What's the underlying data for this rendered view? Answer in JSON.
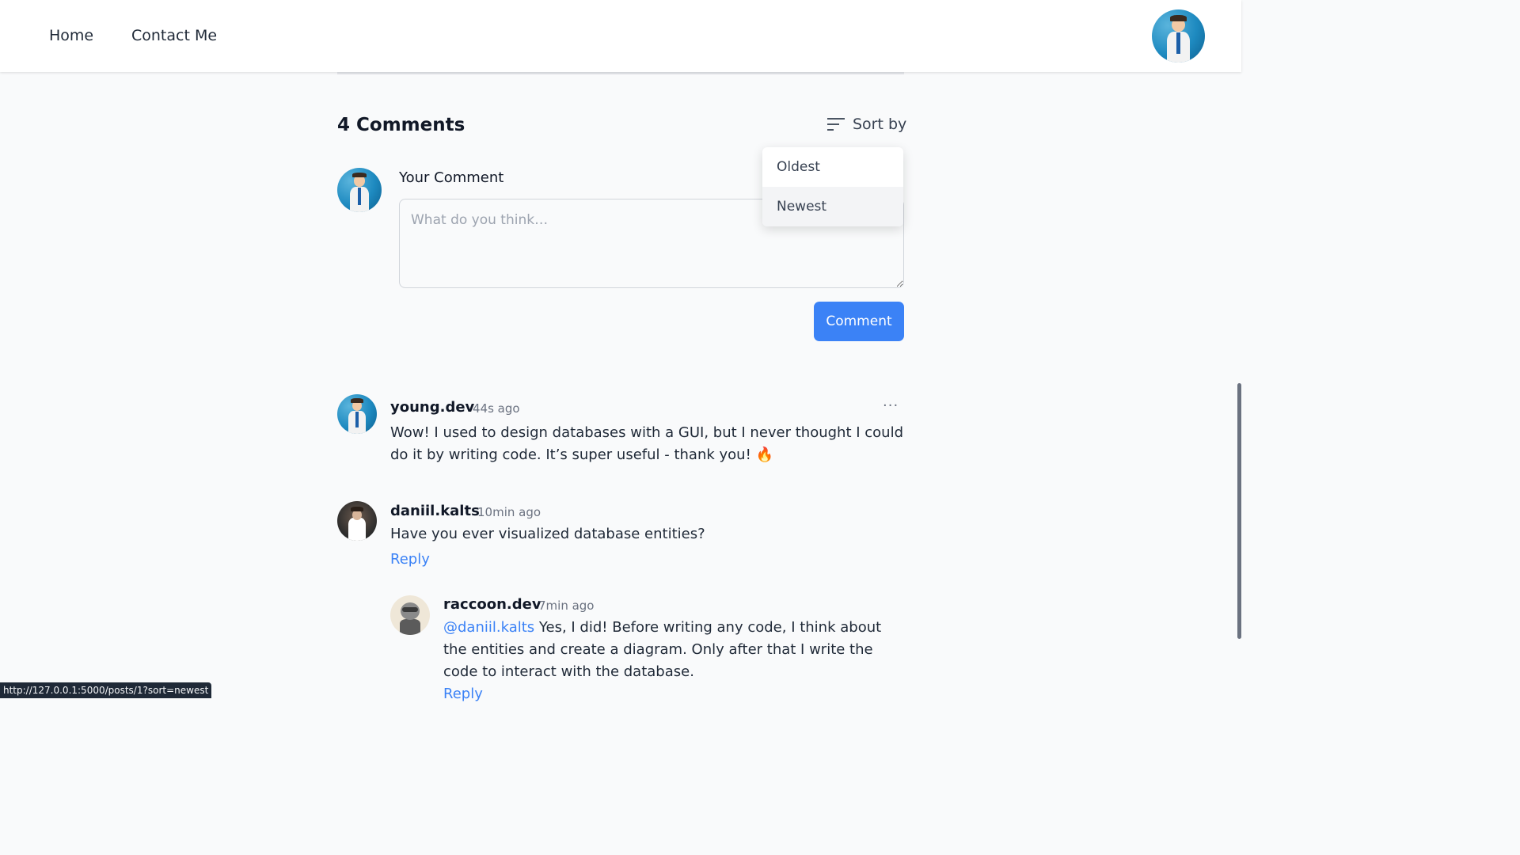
{
  "nav": {
    "home": "Home",
    "contact": "Contact Me"
  },
  "comments": {
    "count_label": "4 Comments",
    "sort_label": "Sort by",
    "sort_options": [
      "Oldest",
      "Newest"
    ],
    "selected_sort": "Newest"
  },
  "compose": {
    "label": "Your Comment",
    "placeholder": "What do you think…",
    "value": "",
    "submit_label": "Comment"
  },
  "items": [
    {
      "author": "young.dev",
      "time": "44s ago",
      "text": "Wow! I used to design databases with a GUI, but I never thought I could do it by writing code. It’s super useful - thank you! 🔥",
      "more": "···"
    },
    {
      "author": "daniil.kalts",
      "time": "10min ago",
      "text": "Have you ever visualized database entities?",
      "reply": "Reply"
    },
    {
      "author": "raccoon.dev",
      "time": "7min ago",
      "mention": "@daniil.kalts",
      "text": " Yes, I did! Before writing any code, I think about the entities and create a diagram. Only after that I write the code to interact with the database.",
      "reply": "Reply"
    }
  ],
  "status_url": "http://127.0.0.1:5000/posts/1?sort=newest",
  "icons": {
    "sort": "sort-lines-icon",
    "more": "more-horizontal-icon"
  },
  "colors": {
    "accent": "#3b82f6",
    "background": "#f9fafb"
  }
}
